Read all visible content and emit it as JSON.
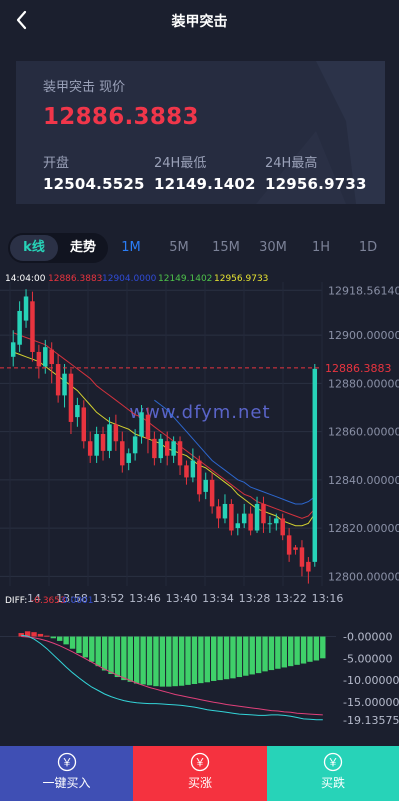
{
  "header": {
    "title": "装甲突击",
    "back_icon": "chevron-left-icon"
  },
  "summary": {
    "caption": "装甲突击 现价",
    "price": "12886.3883",
    "open_label": "开盘",
    "open_value": "12504.5525",
    "low_label": "24H最低",
    "low_value": "12149.1402",
    "high_label": "24H最高",
    "high_value": "12956.9733"
  },
  "view_tabs": {
    "kline": "k线",
    "trend": "走势"
  },
  "periods": [
    "1M",
    "5M",
    "15M",
    "30M",
    "1H",
    "1D"
  ],
  "active_period": "1M",
  "legend": {
    "time": "14:04:00",
    "values": [
      "12886.3883",
      "12904.0000",
      "12149.1402",
      "12956.9733"
    ],
    "colors": [
      "#e8343f",
      "#2f4bd6",
      "#4ec24a",
      "#e8e431"
    ]
  },
  "watermark": "www.dfym.net",
  "chart_data": {
    "type": "candlestick",
    "price_axis": [
      "12918.56140",
      "12900.00000",
      "12880.00000",
      "12860.00000",
      "12840.00000",
      "12820.00000",
      "12800.00000"
    ],
    "price_ylim": [
      12796,
      12922
    ],
    "current_price": 12886.3883,
    "current_price_label": "12886.3883",
    "time_axis": [
      "14",
      "13:58",
      "13:52",
      "13:46",
      "13:40",
      "13:34",
      "13:28",
      "13:22",
      "13:16"
    ],
    "candles": [
      {
        "o": 12891,
        "c": 12897,
        "h": 12902,
        "l": 12887
      },
      {
        "o": 12896,
        "c": 12910,
        "h": 12914,
        "l": 12893
      },
      {
        "o": 12906,
        "c": 12916,
        "h": 12919,
        "l": 12903
      },
      {
        "o": 12914,
        "c": 12893,
        "h": 12918,
        "l": 12889
      },
      {
        "o": 12893,
        "c": 12887,
        "h": 12896,
        "l": 12882
      },
      {
        "o": 12887,
        "c": 12895,
        "h": 12898,
        "l": 12884
      },
      {
        "o": 12894,
        "c": 12888,
        "h": 12897,
        "l": 12880
      },
      {
        "o": 12888,
        "c": 12875,
        "h": 12892,
        "l": 12872
      },
      {
        "o": 12875,
        "c": 12884,
        "h": 12888,
        "l": 12870
      },
      {
        "o": 12884,
        "c": 12864,
        "h": 12886,
        "l": 12859
      },
      {
        "o": 12866,
        "c": 12871,
        "h": 12874,
        "l": 12862
      },
      {
        "o": 12870,
        "c": 12856,
        "h": 12873,
        "l": 12853
      },
      {
        "o": 12856,
        "c": 12850,
        "h": 12860,
        "l": 12847
      },
      {
        "o": 12850,
        "c": 12859,
        "h": 12862,
        "l": 12847
      },
      {
        "o": 12859,
        "c": 12852,
        "h": 12862,
        "l": 12848
      },
      {
        "o": 12852,
        "c": 12863,
        "h": 12866,
        "l": 12849
      },
      {
        "o": 12863,
        "c": 12856,
        "h": 12867,
        "l": 12852
      },
      {
        "o": 12856,
        "c": 12846,
        "h": 12860,
        "l": 12843
      },
      {
        "o": 12847,
        "c": 12851,
        "h": 12853,
        "l": 12844
      },
      {
        "o": 12851,
        "c": 12858,
        "h": 12861,
        "l": 12848
      },
      {
        "o": 12858,
        "c": 12868,
        "h": 12871,
        "l": 12855
      },
      {
        "o": 12867,
        "c": 12857,
        "h": 12870,
        "l": 12851
      },
      {
        "o": 12857,
        "c": 12849,
        "h": 12860,
        "l": 12846
      },
      {
        "o": 12849,
        "c": 12857,
        "h": 12859,
        "l": 12847
      },
      {
        "o": 12856,
        "c": 12850,
        "h": 12860,
        "l": 12846
      },
      {
        "o": 12850,
        "c": 12856,
        "h": 12858,
        "l": 12847
      },
      {
        "o": 12856,
        "c": 12846,
        "h": 12858,
        "l": 12842
      },
      {
        "o": 12846,
        "c": 12841,
        "h": 12848,
        "l": 12838
      },
      {
        "o": 12841,
        "c": 12848,
        "h": 12853,
        "l": 12839
      },
      {
        "o": 12848,
        "c": 12834,
        "h": 12850,
        "l": 12831
      },
      {
        "o": 12835,
        "c": 12840,
        "h": 12843,
        "l": 12832
      },
      {
        "o": 12840,
        "c": 12829,
        "h": 12843,
        "l": 12826
      },
      {
        "o": 12829,
        "c": 12824,
        "h": 12832,
        "l": 12820
      },
      {
        "o": 12824,
        "c": 12830,
        "h": 12834,
        "l": 12822
      },
      {
        "o": 12830,
        "c": 12819,
        "h": 12832,
        "l": 12817
      },
      {
        "o": 12820,
        "c": 12822,
        "h": 12826,
        "l": 12817
      },
      {
        "o": 12822,
        "c": 12826,
        "h": 12830,
        "l": 12820
      },
      {
        "o": 12826,
        "c": 12819,
        "h": 12829,
        "l": 12817
      },
      {
        "o": 12819,
        "c": 12830,
        "h": 12833,
        "l": 12818
      },
      {
        "o": 12830,
        "c": 12822,
        "h": 12833,
        "l": 12818
      },
      {
        "o": 12822,
        "c": 12822,
        "h": 12825,
        "l": 12818
      },
      {
        "o": 12822,
        "c": 12824,
        "h": 12826,
        "l": 12819
      },
      {
        "o": 12824,
        "c": 12817,
        "h": 12826,
        "l": 12815
      },
      {
        "o": 12817,
        "c": 12809,
        "h": 12820,
        "l": 12806
      },
      {
        "o": 12812,
        "c": 12811,
        "h": 12813,
        "l": 12809
      },
      {
        "o": 12812,
        "c": 12804,
        "h": 12815,
        "l": 12800
      },
      {
        "o": 12806,
        "c": 12802,
        "h": 12808,
        "l": 12797
      },
      {
        "o": 12806,
        "c": 12886,
        "h": 12888,
        "l": 12804
      }
    ],
    "ma_series": [
      {
        "color": "#e8e431",
        "values": [
          12893,
          12892,
          12891,
          12890,
          12889,
          12887,
          12885,
          12883,
          12881,
          12879,
          12877,
          12874,
          12871,
          12868,
          12866,
          12864,
          12863,
          12862,
          12861,
          12859,
          12858,
          12857,
          12856,
          12855,
          12853,
          12852,
          12851,
          12850,
          12848,
          12846,
          12845,
          12843,
          12841,
          12839,
          12837,
          12834,
          12832,
          12830,
          12828,
          12827,
          12826,
          12825,
          12823,
          12822,
          12821,
          12821,
          12822,
          12826
        ]
      },
      {
        "color": "#e8343f",
        "values": [
          12901,
          12900,
          12899,
          12898,
          12897,
          12896,
          12894,
          12892,
          12890,
          12888,
          12886,
          12884,
          12882,
          12879,
          12877,
          12875,
          12873,
          12871,
          12869,
          12867,
          12866,
          12864,
          12862,
          12860,
          12858,
          12856,
          12854,
          12852,
          12850,
          12848,
          12846,
          12844,
          12842,
          12840,
          12838,
          12836,
          12834,
          12833,
          12831,
          12830,
          12829,
          12828,
          12827,
          12826,
          12825,
          12824,
          12825,
          12828
        ]
      },
      {
        "color": "#2f6fe0",
        "values": [
          null,
          null,
          null,
          null,
          null,
          null,
          null,
          null,
          null,
          null,
          null,
          null,
          null,
          null,
          null,
          null,
          null,
          null,
          null,
          null,
          null,
          null,
          12873,
          12871,
          12869,
          12866,
          12863,
          12860,
          12857,
          12854,
          12851,
          12848,
          12846,
          12844,
          12842,
          12840,
          12839,
          12837,
          12836,
          12835,
          12834,
          12833,
          12832,
          12831,
          12830,
          12830,
          12831,
          12833
        ]
      }
    ],
    "macd_label": "DIFF:",
    "macd_label_values": [
      "-0.3653",
      "0.0001"
    ],
    "macd_axis": [
      "-0.00000",
      "-5.00000",
      "-10.00000",
      "-15.00000",
      "-19.13575"
    ],
    "macd_ylim": [
      -21,
      1.5
    ],
    "macd_bars": [
      0.8,
      1.2,
      1.0,
      0.6,
      0.2,
      -0.4,
      -1.0,
      -1.8,
      -2.8,
      -3.8,
      -4.8,
      -5.8,
      -6.8,
      -7.8,
      -8.6,
      -9.3,
      -10.0,
      -10.4,
      -10.8,
      -11.0,
      -11.2,
      -11.4,
      -11.5,
      -11.5,
      -11.4,
      -11.3,
      -11.1,
      -10.9,
      -10.7,
      -10.5,
      -10.2,
      -10.0,
      -9.8,
      -9.6,
      -9.3,
      -9.0,
      -8.7,
      -8.4,
      -8.0,
      -7.7,
      -7.4,
      -7.1,
      -6.8,
      -6.5,
      -6.2,
      -5.8,
      -5.5,
      -5.0
    ],
    "diff_line": [
      0.3,
      0.1,
      -0.6,
      -1.6,
      -2.8,
      -4.2,
      -5.6,
      -7.0,
      -8.3,
      -9.5,
      -10.6,
      -11.6,
      -12.4,
      -13.2,
      -13.8,
      -14.3,
      -14.7,
      -15.0,
      -15.2,
      -15.3,
      -15.4,
      -15.4,
      -15.5,
      -15.6,
      -15.7,
      -15.8,
      -16.0,
      -16.2,
      -16.5,
      -16.8,
      -17.0,
      -17.2,
      -17.4,
      -17.6,
      -17.8,
      -17.9,
      -18.0,
      -18.1,
      -18.1,
      -18.0,
      -18.0,
      -18.1,
      -18.3,
      -18.6,
      -18.9,
      -19.0,
      -19.1,
      -19.1
    ],
    "dea_line": [
      0.0,
      -0.1,
      -0.3,
      -0.6,
      -1.0,
      -1.5,
      -2.1,
      -2.8,
      -3.5,
      -4.3,
      -5.1,
      -5.9,
      -6.7,
      -7.5,
      -8.2,
      -8.9,
      -9.5,
      -10.1,
      -10.7,
      -11.2,
      -11.7,
      -12.1,
      -12.5,
      -12.9,
      -13.3,
      -13.6,
      -13.9,
      -14.2,
      -14.5,
      -14.8,
      -15.1,
      -15.3,
      -15.6,
      -15.8,
      -16.0,
      -16.2,
      -16.4,
      -16.6,
      -16.8,
      -17.0,
      -17.1,
      -17.3,
      -17.4,
      -17.6,
      -17.7,
      -17.8,
      -17.9,
      -18.0
    ]
  },
  "actions": {
    "buy_now": "一键买入",
    "buy_up": "买涨",
    "buy_down": "买跌",
    "currency_icon": "￥",
    "buy_now_color": "#3f4fb4",
    "buy_up_color": "#f5323f",
    "buy_down_color": "#27d3b8"
  }
}
